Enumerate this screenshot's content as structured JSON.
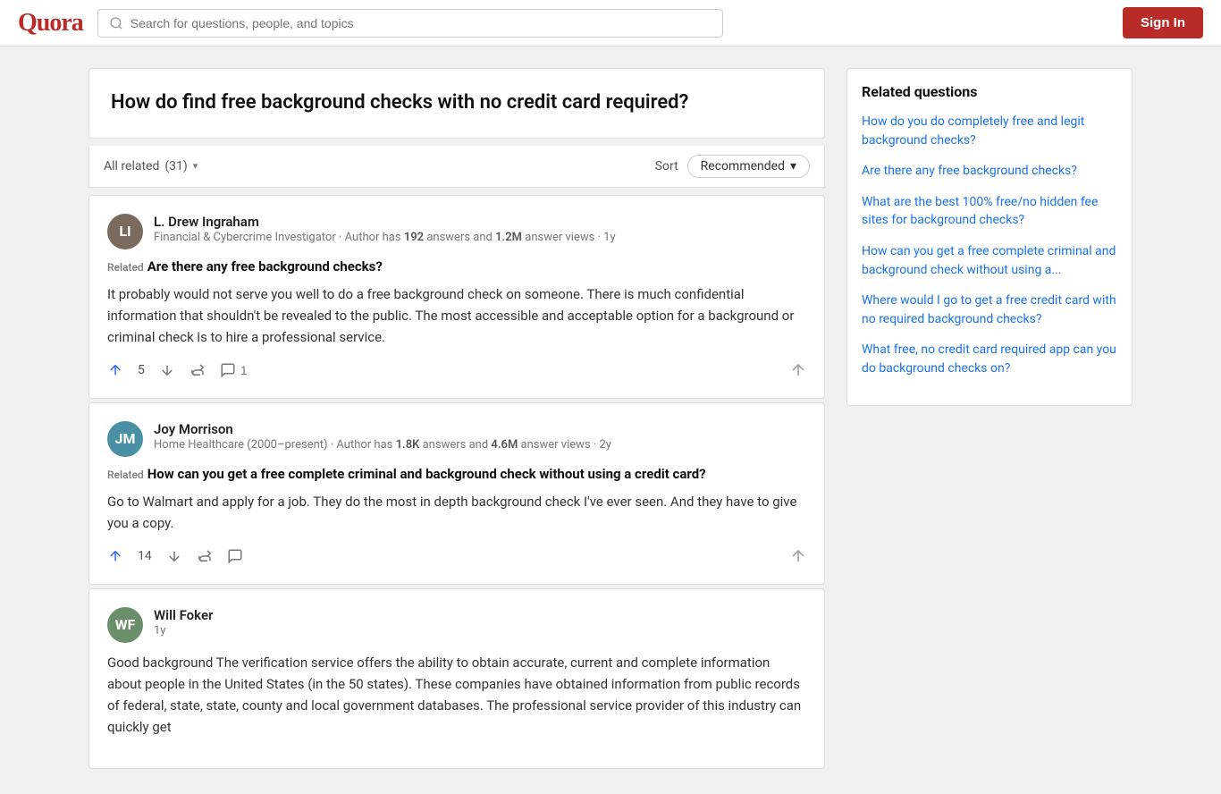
{
  "header": {
    "logo": "Quora",
    "search_placeholder": "Search for questions, people, and topics",
    "sign_in_label": "Sign In"
  },
  "question": {
    "title": "How do find free background checks with no credit card required?"
  },
  "filter": {
    "all_related_label": "All related",
    "count": "(31)",
    "sort_label": "Sort",
    "sort_value": "Recommended"
  },
  "answers": [
    {
      "id": "answer-1",
      "author": "L. Drew Ingraham",
      "avatar_initials": "LI",
      "avatar_class": "avatar-li",
      "role": "Financial & Cybercrime Investigator",
      "author_note": "Author has",
      "answers_count": "192",
      "answers_label": "answers and",
      "views_count": "1.2M",
      "views_label": "answer views",
      "time_ago": "1y",
      "related_label": "Related",
      "related_question": "Are there any free background checks?",
      "text": "It probably would not serve you well to do a free background check on someone. There is much confidential information that shouldn't be revealed to the public. The most accessible and acceptable option for a background or criminal check is to hire a professional service.",
      "upvote_count": "5",
      "comment_count": "1",
      "has_share": true
    },
    {
      "id": "answer-2",
      "author": "Joy Morrison",
      "avatar_initials": "JM",
      "avatar_class": "avatar-jm",
      "role": "Home Healthcare (2000–present)",
      "author_note": "Author has",
      "answers_count": "1.8K",
      "answers_label": "answers and",
      "views_count": "4.6M",
      "views_label": "answer views",
      "time_ago": "2y",
      "related_label": "Related",
      "related_question": "How can you get a free complete criminal and background check without using a credit card?",
      "text": "Go to Walmart and apply for a job. They do the most in depth background check I've ever seen. And they have to give you a copy.",
      "upvote_count": "14",
      "comment_count": "",
      "has_share": true
    },
    {
      "id": "answer-3",
      "author": "Will Foker",
      "avatar_initials": "WF",
      "avatar_class": "avatar-wf",
      "role": "",
      "author_note": "",
      "answers_count": "",
      "answers_label": "",
      "views_count": "",
      "views_label": "",
      "time_ago": "1y",
      "related_label": "",
      "related_question": "",
      "text": "Good background The verification service offers the ability to obtain accurate, current and complete information about people in the United States (in the 50 states). These companies have obtained information from public records of federal, state, state, county and local government databases. The professional service provider of this industry can quickly get",
      "upvote_count": "",
      "comment_count": "",
      "has_share": false
    }
  ],
  "sidebar": {
    "related_questions_title": "Related questions",
    "items": [
      {
        "text": "How do you do completely free and legit background checks?"
      },
      {
        "text": "Are there any free background checks?"
      },
      {
        "text": "What are the best 100% free/no hidden fee sites for background checks?"
      },
      {
        "text": "How can you get a free complete criminal and background check without using a..."
      },
      {
        "text": "Where would I go to get a free credit card with no required background checks?"
      },
      {
        "text": "What free, no credit card required app can you do background checks on?"
      }
    ]
  }
}
